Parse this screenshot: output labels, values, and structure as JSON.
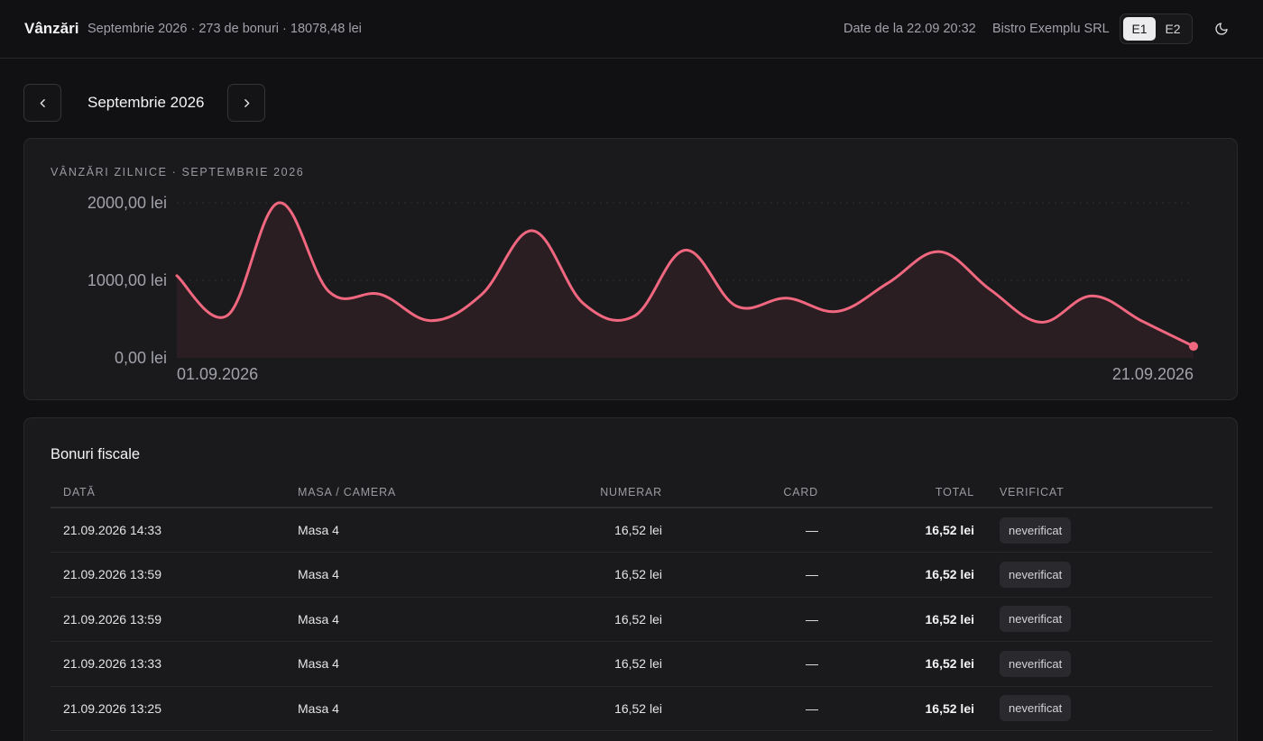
{
  "header": {
    "title": "Vânzări",
    "subtitle": "Septembrie 2026 · 273 de bonuri · 18078,48 lei",
    "updated": "Date de la 22.09 20:32",
    "company": "Bistro Exemplu SRL",
    "terminals": [
      "E1",
      "E2"
    ],
    "active_terminal": "E1",
    "theme_icon": "moon-icon"
  },
  "month_nav": {
    "label": "Septembrie 2026",
    "prev_icon": "chevron-left-icon",
    "next_icon": "chevron-right-icon"
  },
  "chart_title": "VÂNZĂRI ZILNICE · SEPTEMBRIE 2026",
  "chart_data": {
    "type": "area",
    "x": [
      "01.09.2026",
      "02.09.2026",
      "03.09.2026",
      "04.09.2026",
      "05.09.2026",
      "06.09.2026",
      "07.09.2026",
      "08.09.2026",
      "09.09.2026",
      "10.09.2026",
      "11.09.2026",
      "12.09.2026",
      "13.09.2026",
      "14.09.2026",
      "15.09.2026",
      "16.09.2026",
      "17.09.2026",
      "18.09.2026",
      "19.09.2026",
      "20.09.2026",
      "21.09.2026"
    ],
    "y": [
      1060,
      550,
      2000,
      850,
      820,
      480,
      820,
      1640,
      700,
      540,
      1390,
      670,
      770,
      600,
      970,
      1370,
      880,
      460,
      800,
      470,
      150
    ],
    "x_tick_labels": [
      "01.09.2026",
      "21.09.2026"
    ],
    "y_tick_labels": [
      "2000,00 lei",
      "1000,00 lei",
      "0,00 lei"
    ],
    "y_ticks": [
      2000,
      1000,
      0
    ],
    "ylim": [
      0,
      2000
    ],
    "grid": "horizontal dotted",
    "line_color": "#f0677f",
    "fill_color": "#2e1f23"
  },
  "table": {
    "title": "Bonuri fiscale",
    "columns": [
      "DATĂ",
      "MASA / CAMERA",
      "NUMERAR",
      "CARD",
      "TOTAL",
      "VERIFICAT"
    ],
    "rows": [
      {
        "date": "21.09.2026 14:33",
        "table": "Masa 4",
        "cash": "16,52 lei",
        "card": "—",
        "total": "16,52 lei",
        "verified": "neverificat"
      },
      {
        "date": "21.09.2026 13:59",
        "table": "Masa 4",
        "cash": "16,52 lei",
        "card": "—",
        "total": "16,52 lei",
        "verified": "neverificat"
      },
      {
        "date": "21.09.2026 13:59",
        "table": "Masa 4",
        "cash": "16,52 lei",
        "card": "—",
        "total": "16,52 lei",
        "verified": "neverificat"
      },
      {
        "date": "21.09.2026 13:33",
        "table": "Masa 4",
        "cash": "16,52 lei",
        "card": "—",
        "total": "16,52 lei",
        "verified": "neverificat"
      },
      {
        "date": "21.09.2026 13:25",
        "table": "Masa 4",
        "cash": "16,52 lei",
        "card": "—",
        "total": "16,52 lei",
        "verified": "neverificat"
      }
    ]
  }
}
